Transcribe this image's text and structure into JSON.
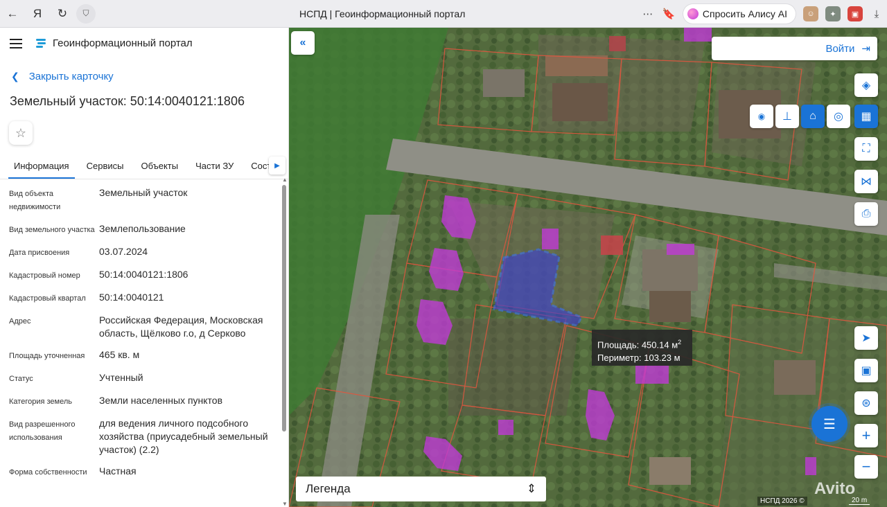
{
  "browser": {
    "tab_title": "НСПД | Геоинформационный портал",
    "alice_label": "Спросить Алису AI"
  },
  "app": {
    "title": "Геоинформационный портал"
  },
  "card": {
    "back_label": "Закрыть карточку",
    "title": "Земельный участок: 50:14:0040121:1806"
  },
  "tabs": [
    {
      "label": "Информация"
    },
    {
      "label": "Сервисы"
    },
    {
      "label": "Объекты"
    },
    {
      "label": "Части ЗУ"
    },
    {
      "label": "Состав"
    }
  ],
  "info": [
    {
      "label": "Вид объекта недвижимости",
      "value": "Земельный участок"
    },
    {
      "label": "Вид земельного участка",
      "value": "Землепользование"
    },
    {
      "label": "Дата присвоения",
      "value": "03.07.2024"
    },
    {
      "label": "Кадастровый номер",
      "value": "50:14:0040121:1806"
    },
    {
      "label": "Кадастровый квартал",
      "value": "50:14:0040121"
    },
    {
      "label": "Адрес",
      "value": "Российская Федерация, Московская область, Щёлково г.о, д Серково"
    },
    {
      "label": "Площадь уточненная",
      "value": "465 кв. м"
    },
    {
      "label": "Статус",
      "value": "Учтенный"
    },
    {
      "label": "Категория земель",
      "value": "Земли населенных пунктов"
    },
    {
      "label": "Вид разрешенного использования",
      "value": "для ведения личного подсобного хозяйства (приусадебный земельный участок) (2.2)"
    },
    {
      "label": "Форма собственности",
      "value": "Частная"
    }
  ],
  "map": {
    "login_label": "Войти",
    "tooltip": {
      "area_label": "Площадь:",
      "area_value": "450.14 м",
      "area_unit_sup": "2",
      "perimeter_label": "Периметр:",
      "perimeter_value": "103.23 м"
    },
    "legend_label": "Легенда",
    "attribution": "НСПД 2026 ©",
    "scale": "20 m",
    "watermark": "Avito",
    "controls": [
      "layers-icon",
      "point-measure-icon",
      "line-measure-icon",
      "area-measure-icon",
      "circle-measure-icon",
      "ruler-icon",
      "select-area-icon",
      "share-icon",
      "print-icon",
      "locate-icon",
      "minimap-icon",
      "geo-icon",
      "zoom-in-icon",
      "zoom-out-icon"
    ]
  },
  "colors": {
    "accent": "#1a73d6",
    "parcel_highlight": "#3a3fd6",
    "building_fill": "#c23ad8",
    "cadastre_lines": "#e0563f"
  }
}
